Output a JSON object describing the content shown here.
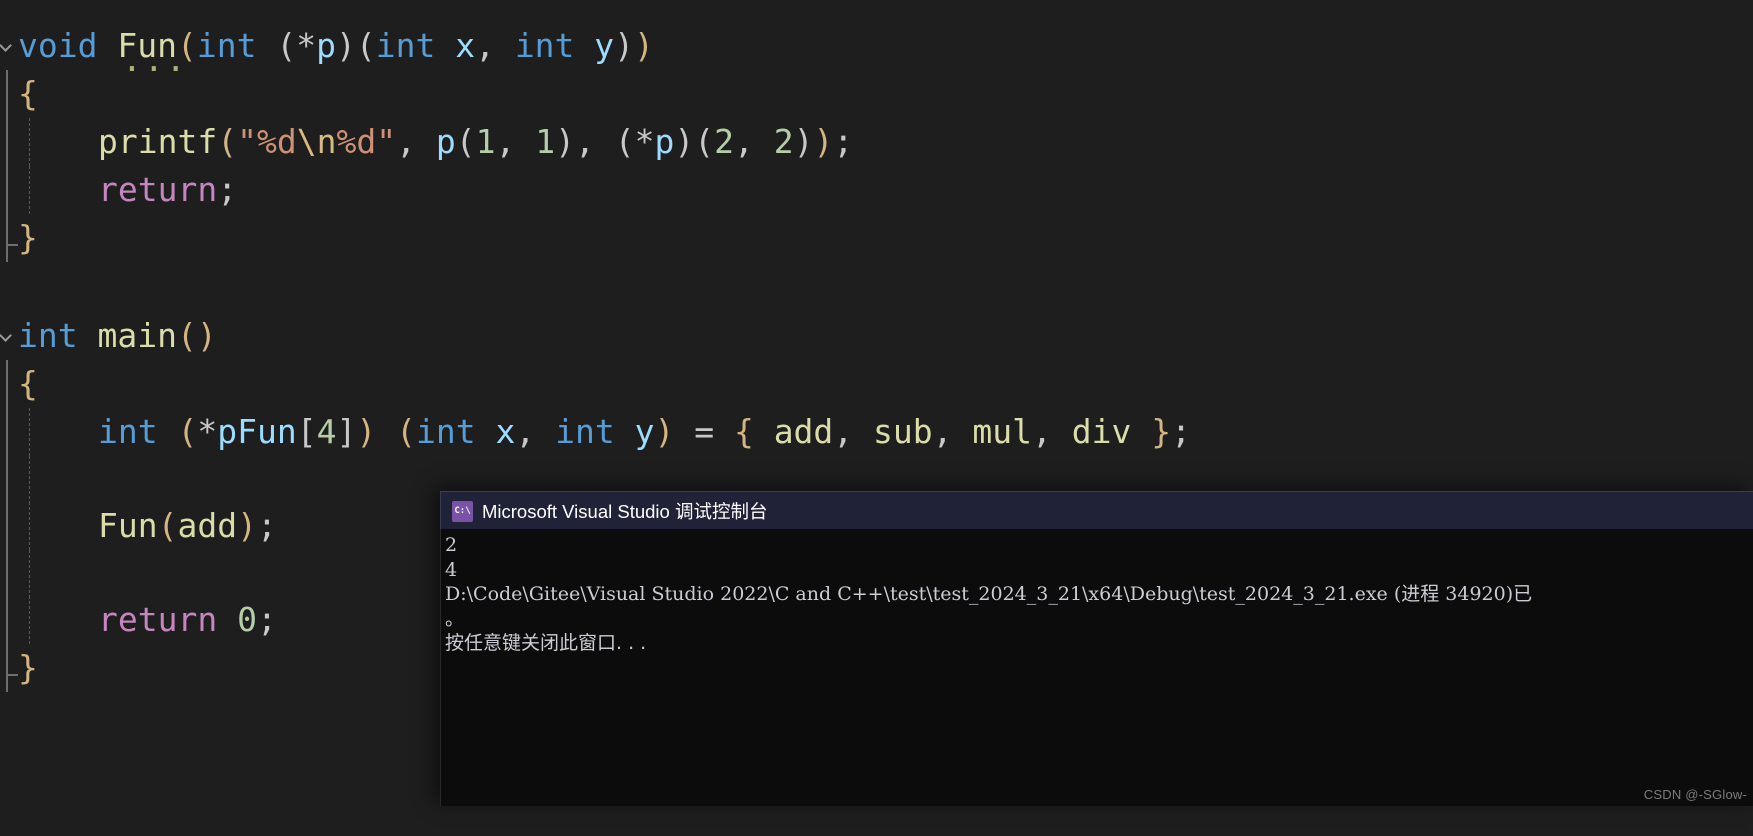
{
  "editor": {
    "theme_background": "#1E1E1E",
    "colors": {
      "keyword": "#569CD6",
      "function": "#DCDCAA",
      "identifier": "#9CDCFE",
      "string": "#CE9178",
      "escape": "#D7BA7D",
      "number": "#B5CEA8",
      "return_keyword": "#C586C0",
      "punctuation": "#C8C8C8",
      "paren_level1": "#D4B483"
    },
    "lines": [
      {
        "id": "l1",
        "text": "void Fun(int (*p)(int x, int y))"
      },
      {
        "id": "l2",
        "text": "{"
      },
      {
        "id": "l3",
        "text": "    printf(\"%d\\n%d\", p(1, 1), (*p)(2, 2));"
      },
      {
        "id": "l4",
        "text": "    return;"
      },
      {
        "id": "l5",
        "text": "}"
      },
      {
        "id": "l6",
        "text": ""
      },
      {
        "id": "l7",
        "text": "int main()"
      },
      {
        "id": "l8",
        "text": "{"
      },
      {
        "id": "l9",
        "text": "    int (*pFun[4]) (int x, int y) = { add, sub, mul, div };"
      },
      {
        "id": "l10",
        "text": ""
      },
      {
        "id": "l11",
        "text": "    Fun(add);"
      },
      {
        "id": "l12",
        "text": ""
      },
      {
        "id": "l13",
        "text": "    return 0;"
      },
      {
        "id": "l14",
        "text": "}"
      }
    ],
    "tokens": {
      "void": "void",
      "int": "int",
      "fun": "Fun",
      "main": "main",
      "printf": "printf",
      "return": "return",
      "p": "p",
      "x": "x",
      "y": "y",
      "pFun": "pFun",
      "add": "add",
      "sub": "sub",
      "mul": "mul",
      "div": "div",
      "format_string_open": "\"%d",
      "format_string_escape": "\\n",
      "format_string_close": "%d\"",
      "num_one": "1",
      "num_two": "2",
      "num_four": "4",
      "num_zero": "0",
      "star": "*",
      "lparen": "(",
      "rparen": ")",
      "lbrace": "{",
      "rbrace": "}",
      "lbracket": "[",
      "rbracket": "]",
      "semicolon": ";",
      "comma": ",",
      "equals": "=",
      "squiggle_dots": "..."
    }
  },
  "console_window": {
    "title": "Microsoft Visual Studio 调试控制台",
    "icon": "console-app-icon",
    "icon_glyph": "C:\\",
    "titlebar_color": "#202338",
    "body_color": "#0C0C0C",
    "output_lines": [
      "2",
      "4",
      "D:\\Code\\Gitee\\Visual Studio 2022\\C and C++\\test\\test_2024_3_21\\x64\\Debug\\test_2024_3_21.exe (进程 34920)已",
      "。",
      "按任意键关闭此窗口. . ."
    ]
  },
  "watermark": {
    "text": "CSDN @-SGlow-"
  }
}
